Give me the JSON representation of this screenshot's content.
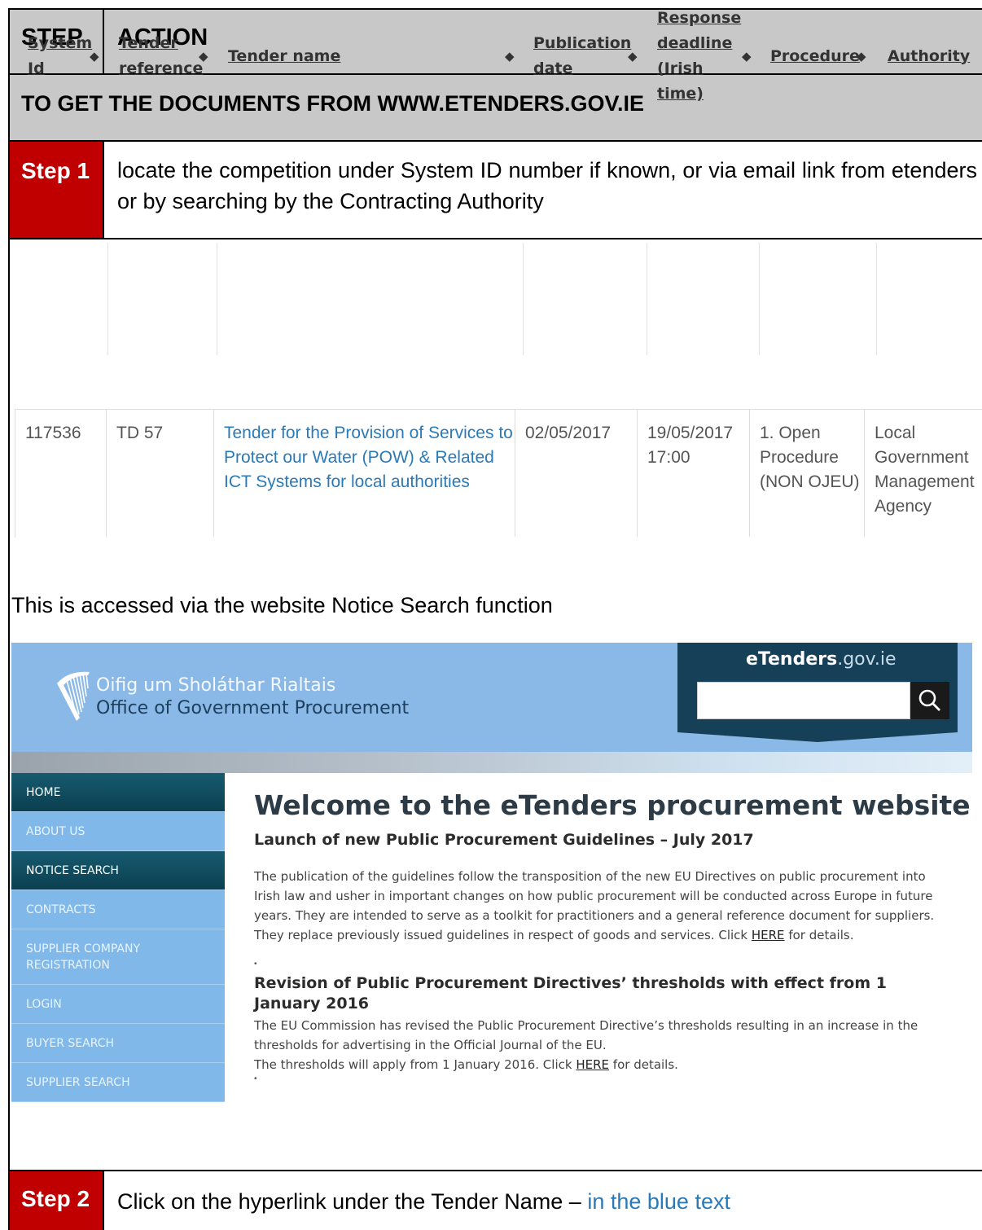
{
  "header": {
    "step": "STEP",
    "action": "ACTION"
  },
  "subheader": "TO GET THE DOCUMENTS FROM WWW.ETENDERS.GOV.IE",
  "step1": {
    "label": "Step 1",
    "text": "locate the competition under System ID number if known, or via email link from etenders or by searching by the Contracting Authority"
  },
  "tender_table": {
    "columns": [
      "System Id",
      "Tender reference",
      "Tender name",
      "Publication date",
      "Response deadline (Irish time)",
      "Procedure",
      "Authority"
    ],
    "row": {
      "system_id": "117536",
      "reference": "TD 57",
      "name": "Tender for the Provision of Services to Protect our Water (POW) & Related ICT Systems for local authorities",
      "publication_date": "02/05/2017",
      "deadline_date": "19/05/2017",
      "deadline_time": "17:00",
      "procedure": "1. Open Procedure (NON OJEU)",
      "authority": "Local Government Management Agency"
    }
  },
  "access_text": "This is accessed via the website Notice Search function",
  "website": {
    "org_irish": "Oifig um Sholáthar Rialtais",
    "org_english": "Office of Government Procurement",
    "logo_bold": "eTenders",
    "logo_light": ".gov.ie",
    "nav": [
      "HOME",
      "ABOUT US",
      "NOTICE SEARCH",
      "CONTRACTS",
      "SUPPLIER COMPANY REGISTRATION",
      "LOGIN",
      "BUYER SEARCH",
      "SUPPLIER SEARCH"
    ],
    "welcome": "Welcome to the eTenders procurement website",
    "news1_title": "Launch of new Public Procurement Guidelines – July 2017",
    "news1_body": "The publication of the guidelines follow the transposition of the new EU Directives on public procurement into Irish law and usher in important changes on how public procurement will be conducted across Europe in future years. They are intended to serve as a toolkit for practitioners and a general reference document for suppliers. They replace previously issued guidelines in respect of goods and services. Click",
    "here": "HERE",
    "for_details": "for details.",
    "news2_title": "Revision of Public Procurement Directives’ thresholds with effect from 1 January 2016",
    "news2_body1": "The EU Commission has revised the Public Procurement Directive’s thresholds resulting in an increase in the thresholds for advertising in the Official Journal of the EU.",
    "news2_body2": "The thresholds will apply from 1 January 2016. Click",
    "bullet": "•"
  },
  "step2": {
    "label": "Step 2",
    "text": "Click on the hyperlink under the Tender Name –",
    "blue_text": "in the blue text"
  },
  "icons": {
    "search": "search-icon",
    "harp": "harp-icon",
    "sort": "sort-icon"
  }
}
